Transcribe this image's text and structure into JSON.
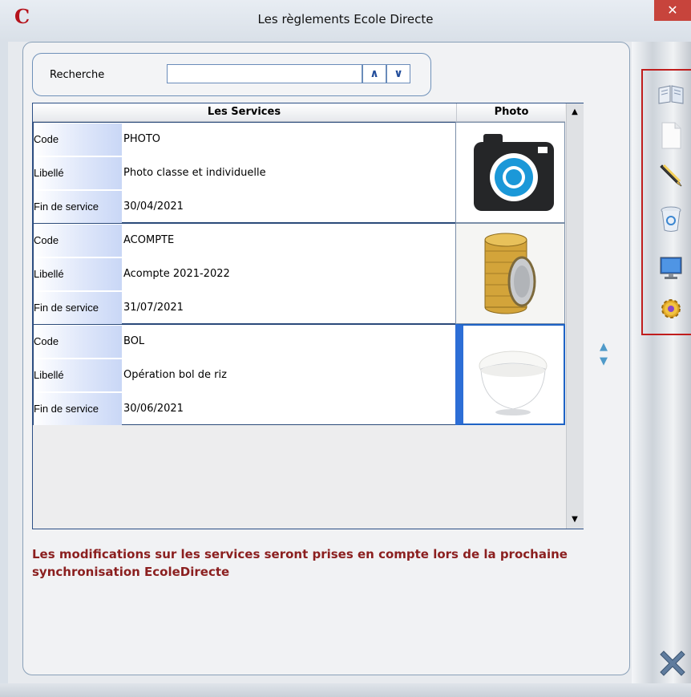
{
  "window": {
    "title": "Les règlements Ecole Directe",
    "logo_letter": "C",
    "close_glyph": "✕"
  },
  "search": {
    "label": "Recherche",
    "value": "",
    "placeholder": "",
    "up_glyph": "∧",
    "down_glyph": "∨"
  },
  "grid": {
    "headers": {
      "services": "Les Services",
      "photo": "Photo"
    },
    "field_labels": {
      "code": "Code",
      "libelle": "Libellé",
      "fin": "Fin de service"
    },
    "records": [
      {
        "code": "PHOTO",
        "libelle": "Photo classe et individuelle",
        "fin": "30/04/2021",
        "photo_icon": "camera-icon"
      },
      {
        "code": "ACOMPTE",
        "libelle": "Acompte 2021-2022",
        "fin": "31/07/2021",
        "photo_icon": "coin-stack-icon"
      },
      {
        "code": "BOL",
        "libelle": "Opération bol de riz",
        "fin": "30/06/2021",
        "photo_icon": "rice-bowl-icon",
        "selected": true
      }
    ]
  },
  "message": "Les modifications sur les services seront prises en compte lors de la prochaine synchronisation EcoleDirecte",
  "toolbar": {
    "items": [
      "open-book-icon",
      "new-document-icon",
      "edit-pen-icon",
      "recycle-bin-icon",
      "monitor-icon",
      "settings-gear-icon"
    ]
  },
  "colors": {
    "accent_border": "#c01d1d",
    "message_text": "#8b1f1f",
    "selection": "#2d6ed6"
  }
}
